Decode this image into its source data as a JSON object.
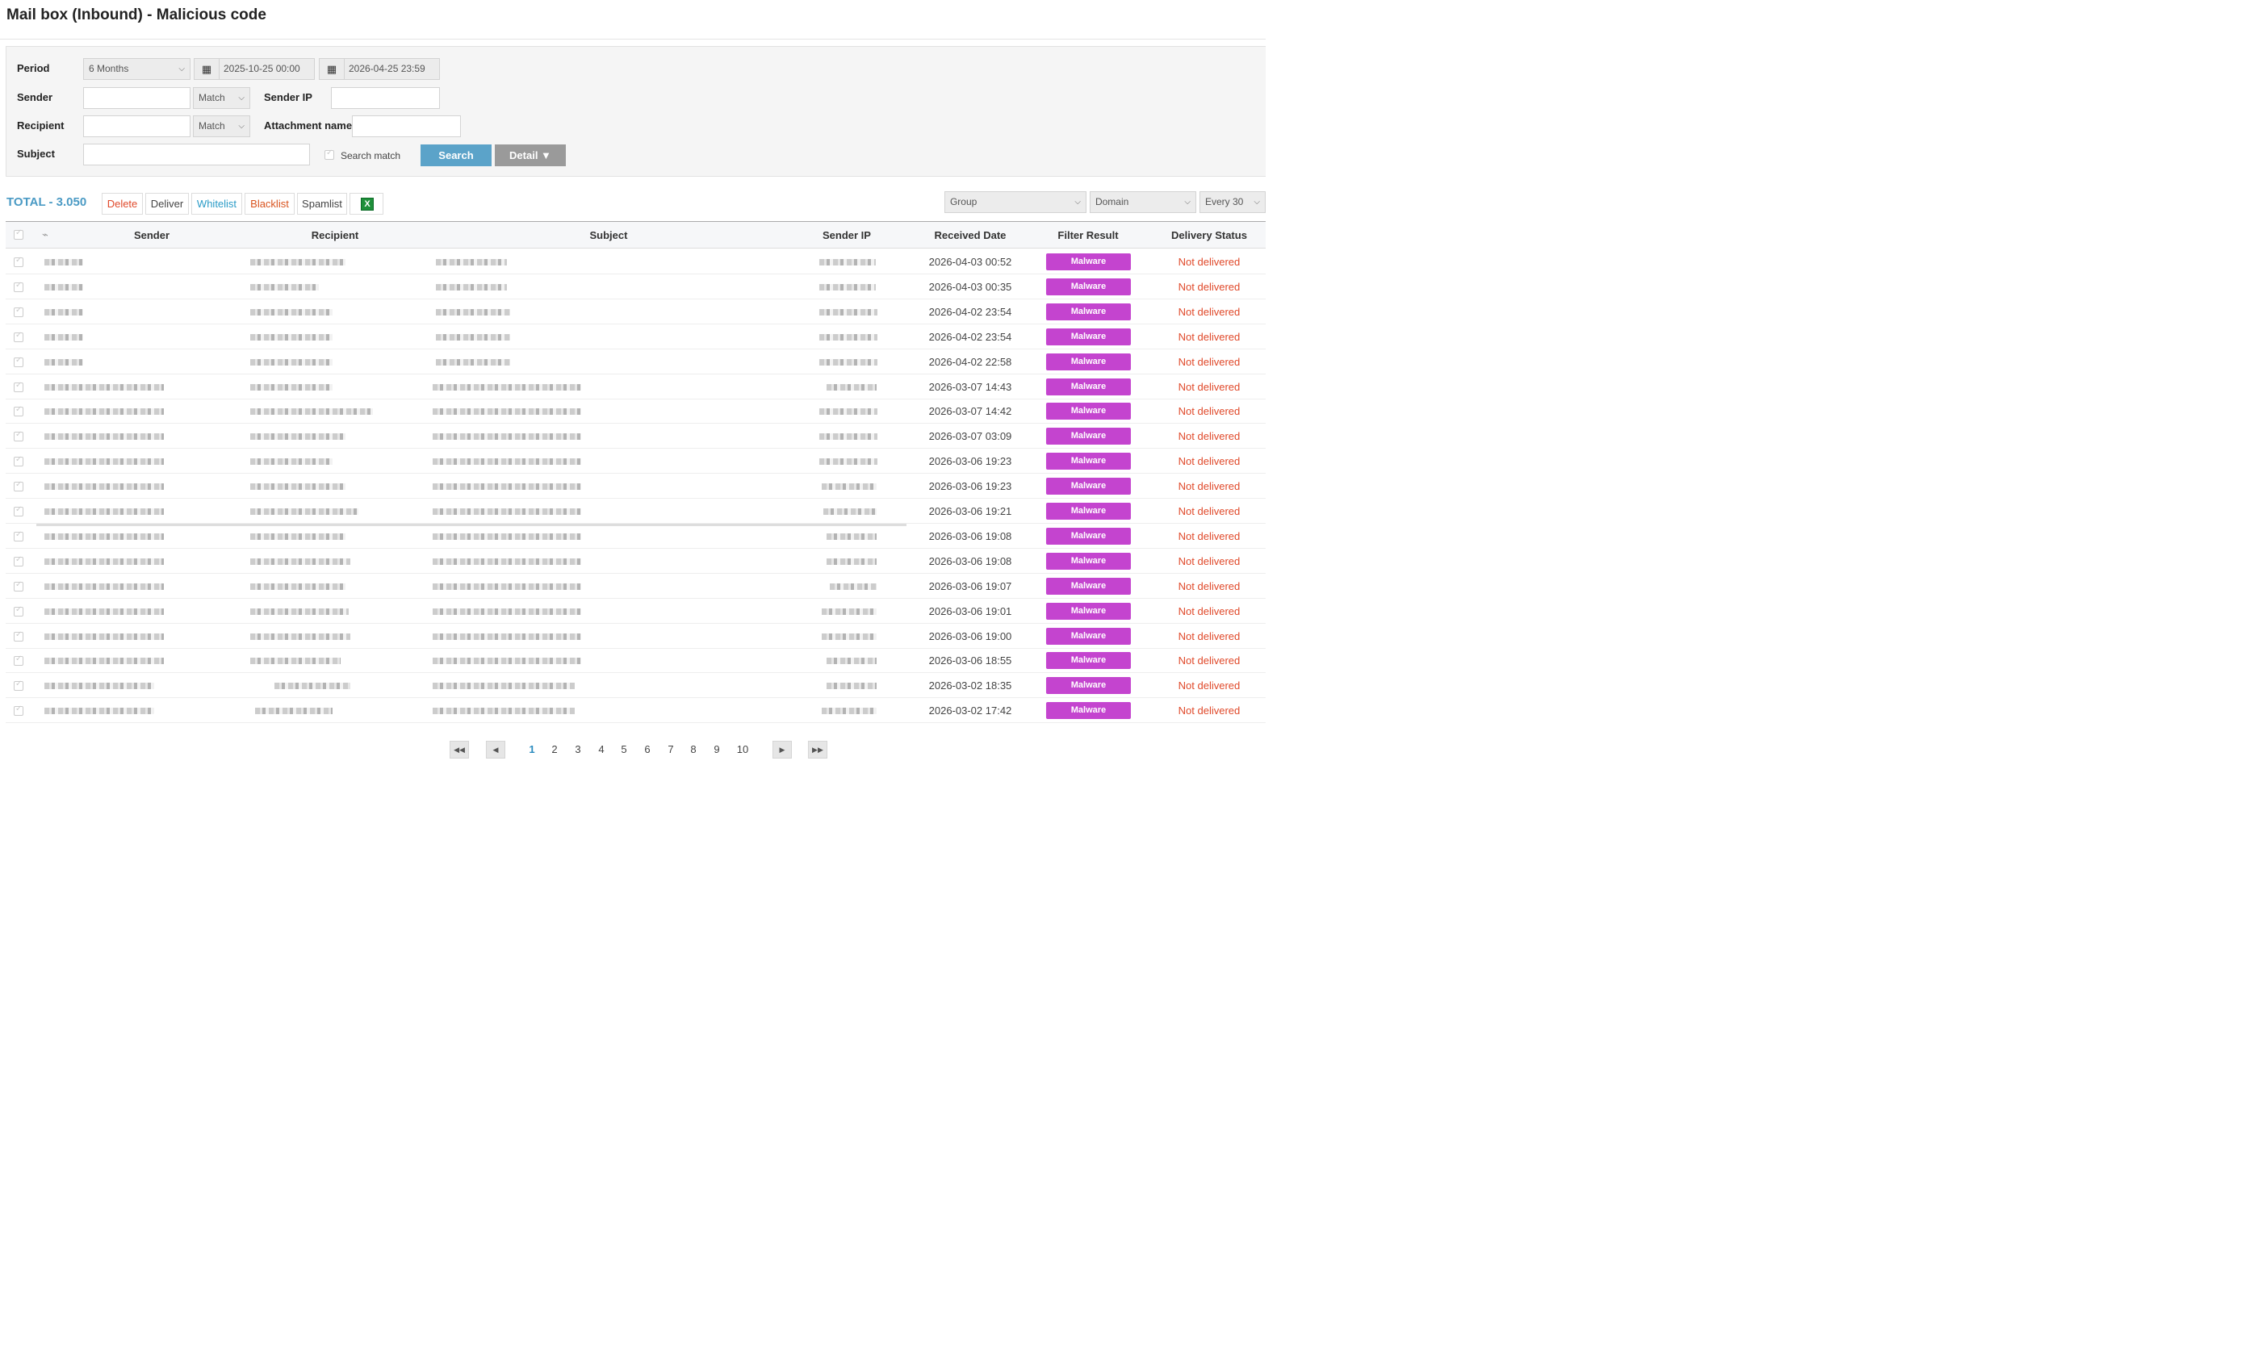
{
  "page_title": "Mail box (Inbound) - Malicious code",
  "filters": {
    "period_label": "Period",
    "period_value": "6 Months",
    "date_from": "2025-10-25 00:00",
    "date_to": "2026-04-25 23:59",
    "sender_label": "Sender",
    "sender_match": "Match",
    "sender_ip_label": "Sender IP",
    "recipient_label": "Recipient",
    "recipient_match": "Match",
    "attachment_label": "Attachment name",
    "subject_label": "Subject",
    "search_match_label": "Search match",
    "search_button": "Search",
    "detail_button": "Detail ▼"
  },
  "toolbar": {
    "total": "TOTAL - 3.050",
    "delete": "Delete",
    "deliver": "Deliver",
    "whitelist": "Whitelist",
    "blacklist": "Blacklist",
    "spamlist": "Spamlist",
    "group_select": "Group",
    "domain_select": "Domain",
    "every_select": "Every 30"
  },
  "table": {
    "headers": [
      "Sender",
      "Recipient",
      "Subject",
      "Sender IP",
      "Received Date",
      "Filter Result",
      "Delivery Status"
    ],
    "rows": [
      {
        "date": "2026-04-03 00:52",
        "result": "Malware",
        "status": "Not delivered"
      },
      {
        "date": "2026-04-03 00:35",
        "result": "Malware",
        "status": "Not delivered"
      },
      {
        "date": "2026-04-02 23:54",
        "result": "Malware",
        "status": "Not delivered"
      },
      {
        "date": "2026-04-02 23:54",
        "result": "Malware",
        "status": "Not delivered"
      },
      {
        "date": "2026-04-02 22:58",
        "result": "Malware",
        "status": "Not delivered"
      },
      {
        "date": "2026-03-07 14:43",
        "result": "Malware",
        "status": "Not delivered"
      },
      {
        "date": "2026-03-07 14:42",
        "result": "Malware",
        "status": "Not delivered"
      },
      {
        "date": "2026-03-07 03:09",
        "result": "Malware",
        "status": "Not delivered"
      },
      {
        "date": "2026-03-06 19:23",
        "result": "Malware",
        "status": "Not delivered"
      },
      {
        "date": "2026-03-06 19:23",
        "result": "Malware",
        "status": "Not delivered"
      },
      {
        "date": "2026-03-06 19:21",
        "result": "Malware",
        "status": "Not delivered"
      },
      {
        "date": "2026-03-06 19:08",
        "result": "Malware",
        "status": "Not delivered"
      },
      {
        "date": "2026-03-06 19:08",
        "result": "Malware",
        "status": "Not delivered"
      },
      {
        "date": "2026-03-06 19:07",
        "result": "Malware",
        "status": "Not delivered"
      },
      {
        "date": "2026-03-06 19:01",
        "result": "Malware",
        "status": "Not delivered"
      },
      {
        "date": "2026-03-06 19:00",
        "result": "Malware",
        "status": "Not delivered"
      },
      {
        "date": "2026-03-06 18:55",
        "result": "Malware",
        "status": "Not delivered"
      },
      {
        "date": "2026-03-02 18:35",
        "result": "Malware",
        "status": "Not delivered"
      },
      {
        "date": "2026-03-02 17:42",
        "result": "Malware",
        "status": "Not delivered"
      }
    ]
  },
  "pagination": {
    "pages": [
      "1",
      "2",
      "3",
      "4",
      "5",
      "6",
      "7",
      "8",
      "9",
      "10"
    ],
    "current": "1"
  },
  "icons": {
    "calendar": "calendar-grid-icon",
    "attachment": "paperclip-icon",
    "excel": "excel-icon"
  },
  "colors": {
    "accent": "#4a9ac4",
    "search_btn": "#5ba3c9",
    "malware_badge": "#c444cf",
    "not_delivered": "#e0492a"
  }
}
